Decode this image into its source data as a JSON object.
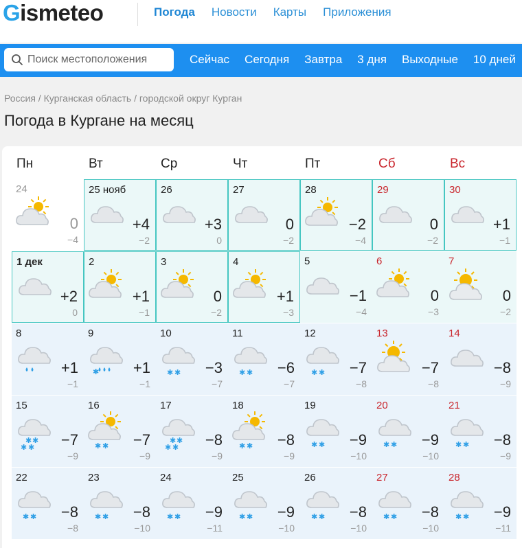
{
  "header": {
    "logo_first": "G",
    "logo_rest": "ismeteo",
    "nav": [
      "Погода",
      "Новости",
      "Карты",
      "Приложения"
    ]
  },
  "search": {
    "placeholder": "Поиск местоположения"
  },
  "periods": [
    "Сейчас",
    "Сегодня",
    "Завтра",
    "3 дня",
    "Выходные",
    "10 дней"
  ],
  "breadcrumb": "Россия / Курганская область / городской округ Курган",
  "page_title": "Погода в Кургане на месяц",
  "colors": {
    "brand": "#2aa3e8",
    "bar": "#1d8ff0",
    "weekend": "#c9262d",
    "highlight": "#45c6c1",
    "snow": "#2f9fe6",
    "sun": "#f5b800"
  },
  "weekdays": [
    {
      "label": "Пн",
      "weekend": false
    },
    {
      "label": "Вт",
      "weekend": false
    },
    {
      "label": "Ср",
      "weekend": false
    },
    {
      "label": "Чт",
      "weekend": false
    },
    {
      "label": "Пт",
      "weekend": false
    },
    {
      "label": "Сб",
      "weekend": true
    },
    {
      "label": "Вс",
      "weekend": true
    }
  ],
  "days": [
    {
      "date": "24",
      "max": "0",
      "min": "−4",
      "icon": "partly-cloudy-icon",
      "past": true
    },
    {
      "date": "25 нояб",
      "max": "+4",
      "min": "−2",
      "icon": "cloud-icon",
      "hl": true
    },
    {
      "date": "26",
      "max": "+3",
      "min": "0",
      "icon": "cloud-icon",
      "hl": true
    },
    {
      "date": "27",
      "max": "0",
      "min": "−2",
      "icon": "cloud-icon",
      "hl": true
    },
    {
      "date": "28",
      "max": "−2",
      "min": "−4",
      "icon": "partly-cloudy-icon",
      "hl": true
    },
    {
      "date": "29",
      "max": "0",
      "min": "−2",
      "icon": "cloud-icon",
      "hl": true,
      "weekend": true
    },
    {
      "date": "30",
      "max": "+1",
      "min": "−1",
      "icon": "cloud-icon",
      "hl": true,
      "weekend": true
    },
    {
      "date": "1 дек",
      "max": "+2",
      "min": "0",
      "icon": "cloud-icon",
      "hl": true,
      "bold": true
    },
    {
      "date": "2",
      "max": "+1",
      "min": "−1",
      "icon": "partly-cloudy-icon",
      "hl": true
    },
    {
      "date": "3",
      "max": "0",
      "min": "−2",
      "icon": "partly-cloudy-icon",
      "hl": true
    },
    {
      "date": "4",
      "max": "+1",
      "min": "−3",
      "icon": "partly-cloudy-icon",
      "hl": true
    },
    {
      "date": "5",
      "max": "−1",
      "min": "−4",
      "icon": "cloud-icon"
    },
    {
      "date": "6",
      "max": "0",
      "min": "−3",
      "icon": "partly-cloudy-icon",
      "weekend": true
    },
    {
      "date": "7",
      "max": "0",
      "min": "−2",
      "icon": "sun-cloud-icon",
      "weekend": true
    },
    {
      "date": "8",
      "max": "+1",
      "min": "−1",
      "icon": "cloud-rain-icon"
    },
    {
      "date": "9",
      "max": "+1",
      "min": "−1",
      "icon": "cloud-rain-snow-icon"
    },
    {
      "date": "10",
      "max": "−3",
      "min": "−7",
      "icon": "cloud-snow-icon"
    },
    {
      "date": "11",
      "max": "−6",
      "min": "−7",
      "icon": "cloud-snow-icon"
    },
    {
      "date": "12",
      "max": "−7",
      "min": "−8",
      "icon": "cloud-snow-icon"
    },
    {
      "date": "13",
      "max": "−7",
      "min": "−8",
      "icon": "sun-cloud-icon",
      "weekend": true
    },
    {
      "date": "14",
      "max": "−8",
      "min": "−9",
      "icon": "cloud-icon",
      "weekend": true
    },
    {
      "date": "15",
      "max": "−7",
      "min": "−9",
      "icon": "cloud-heavy-snow-icon"
    },
    {
      "date": "16",
      "max": "−7",
      "min": "−9",
      "icon": "partly-cloudy-snow-icon"
    },
    {
      "date": "17",
      "max": "−8",
      "min": "−9",
      "icon": "cloud-heavy-snow-icon"
    },
    {
      "date": "18",
      "max": "−8",
      "min": "−9",
      "icon": "partly-cloudy-snow-icon"
    },
    {
      "date": "19",
      "max": "−9",
      "min": "−10",
      "icon": "cloud-snow-icon"
    },
    {
      "date": "20",
      "max": "−9",
      "min": "−10",
      "icon": "cloud-snow-icon",
      "weekend": true
    },
    {
      "date": "21",
      "max": "−8",
      "min": "−9",
      "icon": "cloud-snow-icon",
      "weekend": true
    },
    {
      "date": "22",
      "max": "−8",
      "min": "−8",
      "icon": "cloud-snow-icon"
    },
    {
      "date": "23",
      "max": "−8",
      "min": "−10",
      "icon": "cloud-snow-icon"
    },
    {
      "date": "24",
      "max": "−9",
      "min": "−11",
      "icon": "cloud-snow-icon"
    },
    {
      "date": "25",
      "max": "−9",
      "min": "−10",
      "icon": "cloud-snow-icon"
    },
    {
      "date": "26",
      "max": "−8",
      "min": "−10",
      "icon": "cloud-snow-icon"
    },
    {
      "date": "27",
      "max": "−8",
      "min": "−10",
      "icon": "cloud-snow-icon",
      "weekend": true
    },
    {
      "date": "28",
      "max": "−9",
      "min": "−11",
      "icon": "cloud-snow-icon",
      "weekend": true
    }
  ]
}
